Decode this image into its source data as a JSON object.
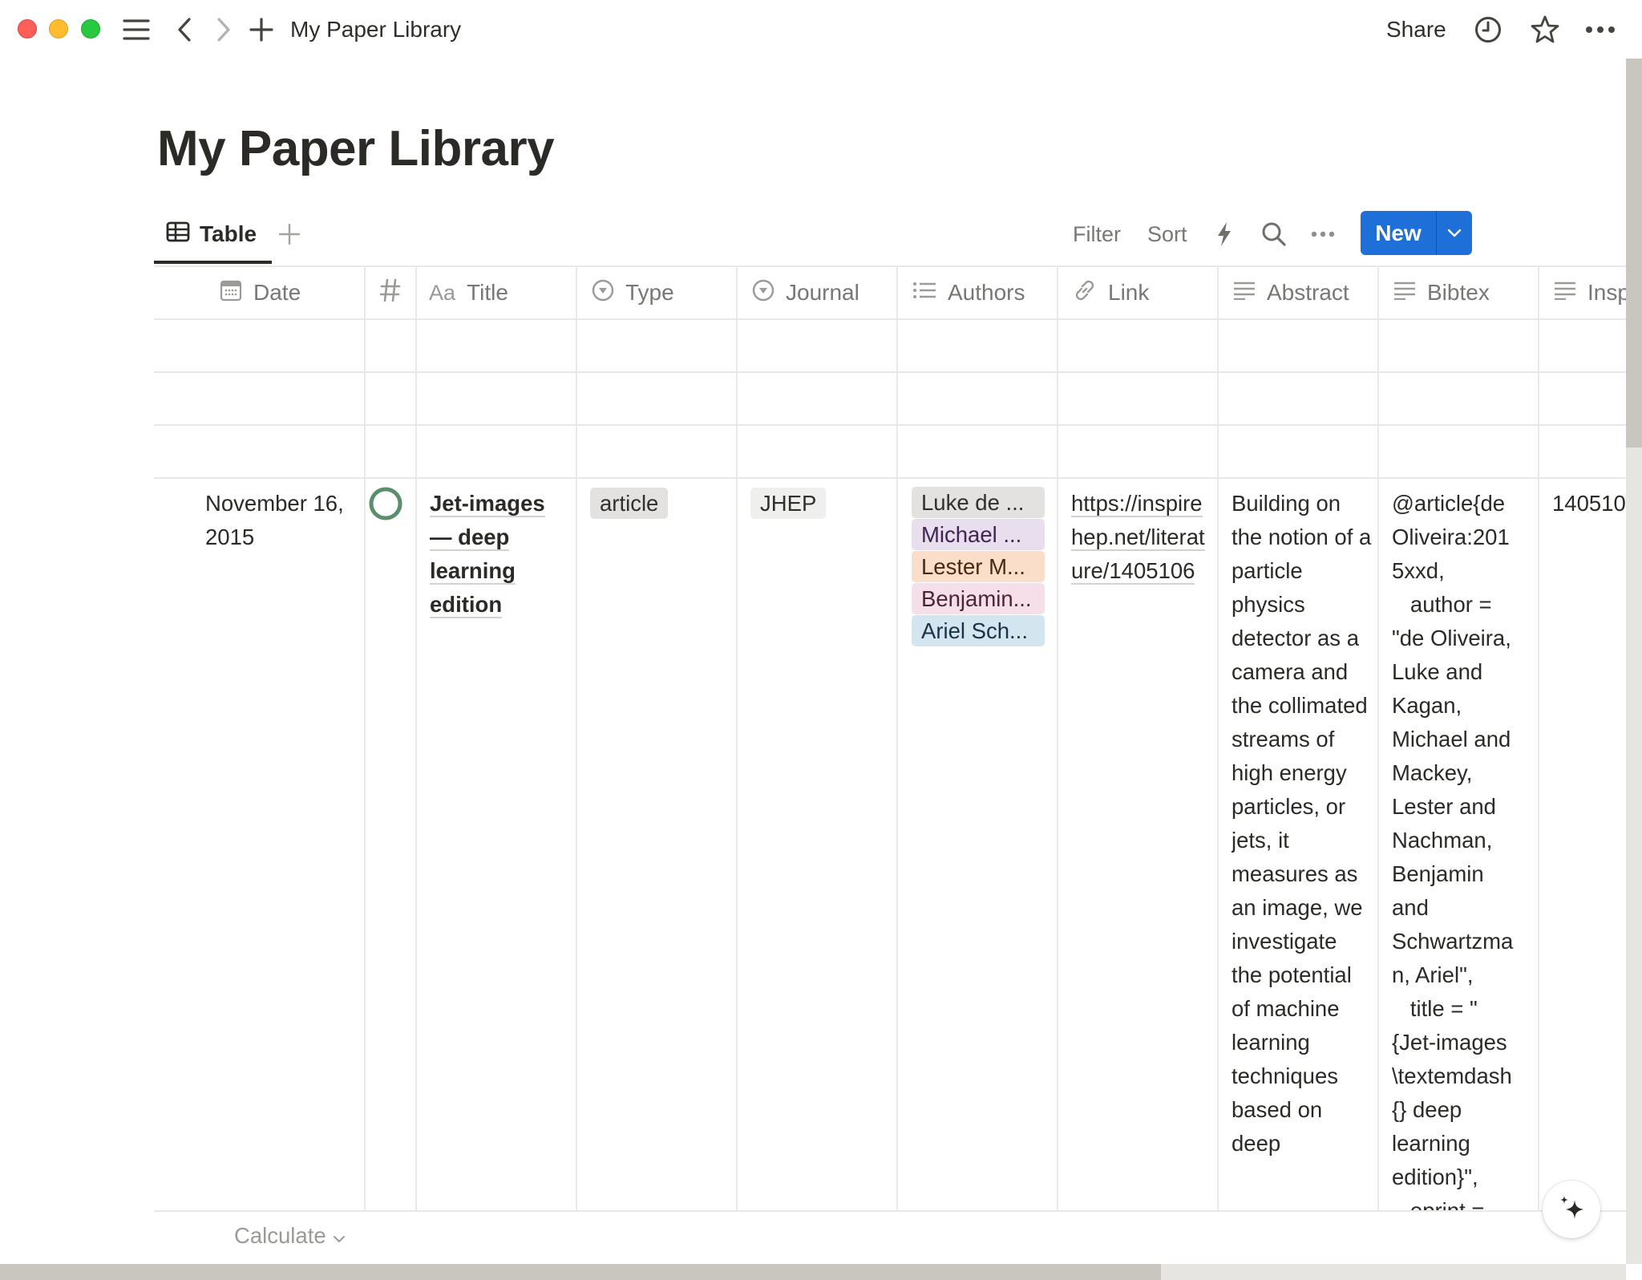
{
  "window": {
    "title": "My Paper Library",
    "share_label": "Share"
  },
  "page": {
    "title": "My Paper Library"
  },
  "views": {
    "tabs": [
      {
        "label": "Table",
        "icon": "table-icon",
        "active": true
      }
    ],
    "add_view_icon": "plus-icon"
  },
  "toolbar": {
    "filter_label": "Filter",
    "sort_label": "Sort",
    "new_label": "New"
  },
  "table": {
    "columns": [
      {
        "label": "Date",
        "icon": "calendar-icon"
      },
      {
        "label": "",
        "icon": "hash-icon"
      },
      {
        "label": "Title",
        "icon": "text-aa-icon"
      },
      {
        "label": "Type",
        "icon": "select-icon"
      },
      {
        "label": "Journal",
        "icon": "select-icon"
      },
      {
        "label": "Authors",
        "icon": "multi-select-icon"
      },
      {
        "label": "Link",
        "icon": "link-icon"
      },
      {
        "label": "Abstract",
        "icon": "text-lines-icon"
      },
      {
        "label": "Bibtex",
        "icon": "text-lines-icon"
      },
      {
        "label": "Insp",
        "icon": "text-lines-icon"
      }
    ],
    "rows": [
      {
        "date": "November 16, 2015",
        "status": "not-started",
        "title": "Jet-images — deep learning edition",
        "type": "article",
        "journal": "JHEP",
        "authors": [
          {
            "label": "Luke de ...",
            "bg": "#e3e2e0",
            "fg": "#32302c"
          },
          {
            "label": "Michael ...",
            "bg": "#e8deee",
            "fg": "#412454"
          },
          {
            "label": "Lester M...",
            "bg": "#fadec9",
            "fg": "#49290e"
          },
          {
            "label": "Benjamin...",
            "bg": "#f5e0e9",
            "fg": "#4c2337"
          },
          {
            "label": "Ariel Sch...",
            "bg": "#d3e5ef",
            "fg": "#183347"
          }
        ],
        "link": "https://inspirehep.net/literature/1405106",
        "abstract": "Building on the notion of a particle physics detector as a camera and the collimated streams of high energy particles, or jets, it measures as an image, we investigate the potential of machine learning techniques based on deep",
        "bibtex_lines": [
          "@article{de",
          "Oliveira:201",
          "5xxd,",
          "   author =",
          "\"de Oliveira,",
          "Luke and",
          "Kagan,",
          "Michael and",
          "Mackey,",
          "Lester and",
          "Nachman,",
          "Benjamin",
          "and",
          "Schwartzma",
          "n, Ariel\",",
          "   title = \"",
          "{Jet-images",
          "\\textemdash",
          "{} deep",
          "learning",
          "edition}\",",
          "   eprint ="
        ],
        "inspire": "140510"
      }
    ],
    "calculate_label": "Calculate"
  },
  "colors": {
    "accent": "#1f6fd8",
    "status_ring": "#5b8f6c",
    "type_pill_bg": "#e3e2e0",
    "journal_pill_bg": "#efefed"
  }
}
